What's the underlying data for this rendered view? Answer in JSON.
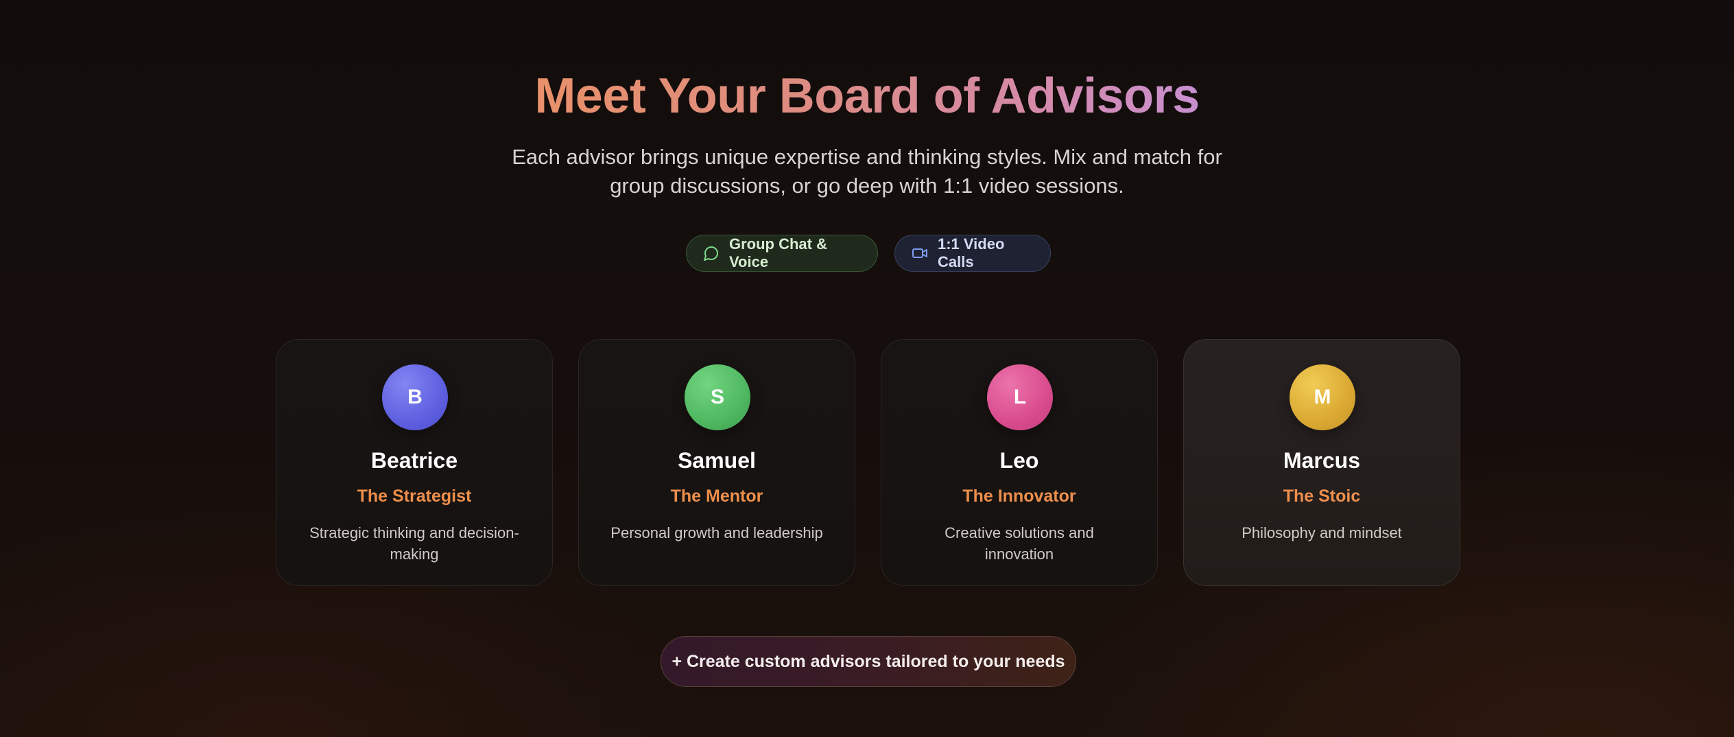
{
  "header": {
    "title": "Meet Your Board of Advisors",
    "subtitle": "Each advisor brings unique expertise and thinking styles. Mix and match for group discussions, or go deep with 1:1 video sessions."
  },
  "features": [
    {
      "label": "Group Chat & Voice",
      "icon": "chat-bubble-icon",
      "color": "#7fd98a"
    },
    {
      "label": "1:1 Video Calls",
      "icon": "video-camera-icon",
      "color": "#7d9cf0"
    }
  ],
  "advisors": [
    {
      "initial": "B",
      "name": "Beatrice",
      "role": "The Strategist",
      "description": "Strategic thinking and decision-making",
      "color": "#5e60e0"
    },
    {
      "initial": "S",
      "name": "Samuel",
      "role": "The Mentor",
      "description": "Personal growth and leadership",
      "color": "#4fb860"
    },
    {
      "initial": "L",
      "name": "Leo",
      "role": "The Innovator",
      "description": "Creative solutions and innovation",
      "color": "#d94c8e"
    },
    {
      "initial": "M",
      "name": "Marcus",
      "role": "The Stoic",
      "description": "Philosophy and mindset",
      "color": "#dba933"
    }
  ],
  "cta": {
    "label": "+ Create custom advisors tailored to your needs"
  },
  "colors": {
    "accent_orange": "#ee8f4c",
    "background": "#140e0c"
  }
}
